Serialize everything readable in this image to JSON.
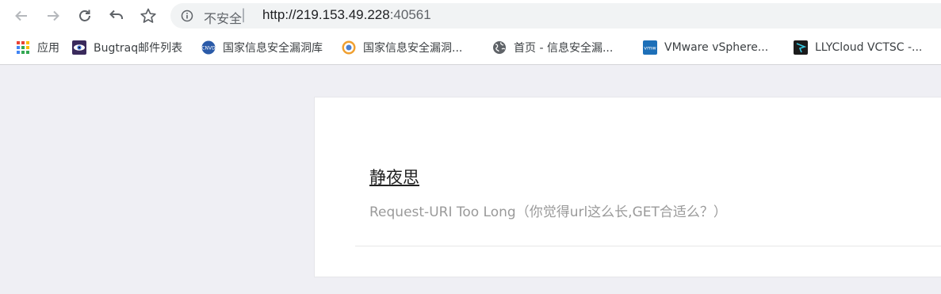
{
  "toolbar": {
    "back_icon": "arrow-left-icon",
    "forward_icon": "arrow-right-icon",
    "reload_icon": "reload-icon",
    "undo_icon": "undo-icon",
    "bookmark_icon": "star-icon"
  },
  "omnibox": {
    "security_label": "不安全",
    "separator": "|",
    "url_host": "http://219.153.49.228",
    "url_port": ":40561"
  },
  "bookmarks": [
    {
      "label": "应用",
      "icon": "apps-grid-icon"
    },
    {
      "label": "Bugtraq邮件列表",
      "icon": "eye-icon"
    },
    {
      "label": "国家信息安全漏洞库",
      "icon": "cnnvd-icon"
    },
    {
      "label": "国家信息安全漏洞...",
      "icon": "globe-colored-icon"
    },
    {
      "label": "首页 - 信息安全漏...",
      "icon": "globe-icon"
    },
    {
      "label": "VMware vSphere...",
      "icon": "vmware-icon"
    },
    {
      "label": "LLYCloud VCTSC -...",
      "icon": "llycloud-icon"
    }
  ],
  "page": {
    "site_title": "静夜思",
    "subtitle": "Request-URI Too Long（你觉得url这么长,GET合适么？）"
  },
  "colors": {
    "page_background": "#efeff4",
    "card_background": "#ffffff",
    "subtitle_text": "#9a9a9a"
  }
}
